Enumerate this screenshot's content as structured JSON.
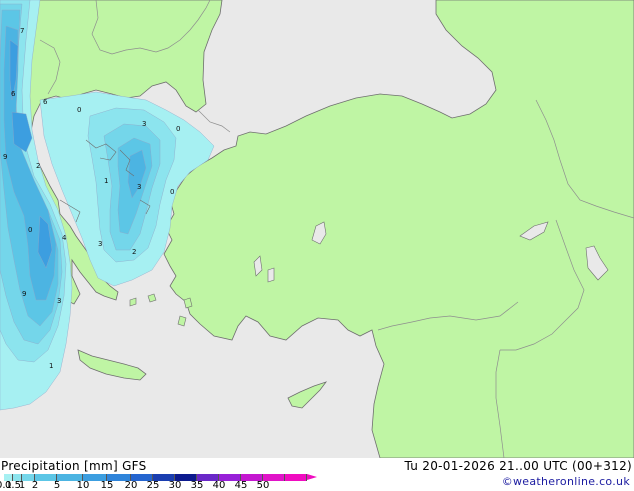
{
  "header": {
    "title": "Precipitation [mm]  GFS",
    "valid_time": "Tu 20-01-2026 21..00 UTC (00+312)",
    "credit": "©weatheronline.co.uk"
  },
  "legend": {
    "ticks": [
      "0.1",
      "0.5",
      "1",
      "2",
      "5",
      "10",
      "15",
      "20",
      "25",
      "30",
      "35",
      "40",
      "45",
      "50"
    ],
    "colors": [
      "#a6f0f2",
      "#8ce4ee",
      "#74d6ea",
      "#5cc6e6",
      "#4cb4e2",
      "#3c9ee0",
      "#2f84da",
      "#2565cf",
      "#1a3eb0",
      "#0c1a8e",
      "#6a28c8",
      "#9820d8",
      "#c417d0",
      "#e014c8",
      "#f00cc0"
    ]
  },
  "map": {
    "colors": {
      "sea": "#e9e9e9",
      "land": "#bff5a4",
      "border": "#8e8e8e",
      "coast": "#6e6e6e"
    },
    "labels": [
      "7",
      "6",
      "6",
      "0",
      "0",
      "3",
      "9",
      "2",
      "1",
      "3",
      "4",
      "3",
      "2",
      "9",
      "3",
      "1",
      "0",
      "0",
      "3"
    ]
  }
}
